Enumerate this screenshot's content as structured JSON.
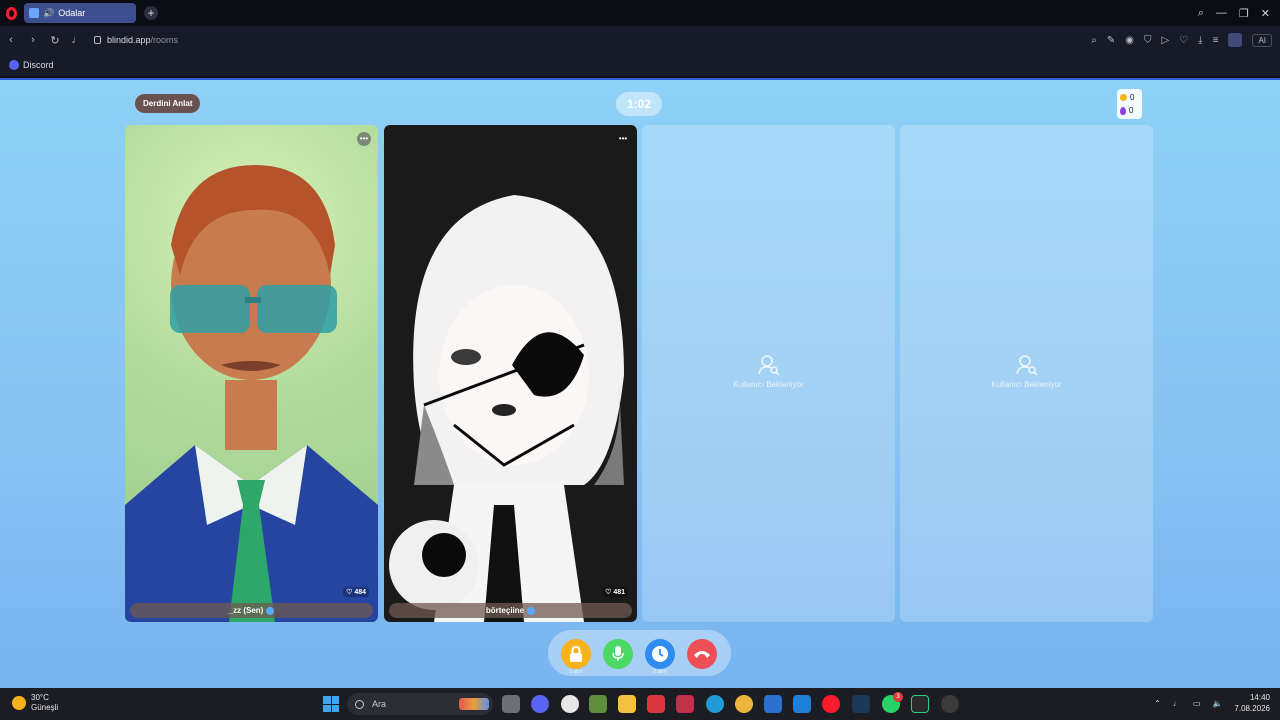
{
  "browser": {
    "tab_title": "Odalar",
    "new_tab": "+",
    "url_host": "blindid.app",
    "url_path": "/rooms",
    "ai_label": "AI",
    "bookmark": "Discord"
  },
  "room": {
    "topic_button": "Derdini Anlat",
    "timer": "1:02",
    "coins": "0",
    "gems": "0",
    "waiting_text": "Kullanıcı Bekleniyor"
  },
  "participants": [
    {
      "name": "_zz (Sen)",
      "likes": "484"
    },
    {
      "name": "börteçiine",
      "likes": "481"
    }
  ],
  "controls": {
    "lock_caption": "5 altın",
    "timer_caption": "2 altın"
  },
  "taskbar": {
    "temperature": "30°C",
    "weather": "Güneşli",
    "search_placeholder": "Ara",
    "time": "14:40",
    "date": "7.08.2026",
    "whatsapp_badge": "3"
  },
  "colors": {
    "page_top": "#8ed0f6",
    "page_bottom": "#78b4f0",
    "lock": "#f7b21c",
    "mic": "#4cd864",
    "clock": "#2e8cf0",
    "end_call": "#ef4f57"
  }
}
